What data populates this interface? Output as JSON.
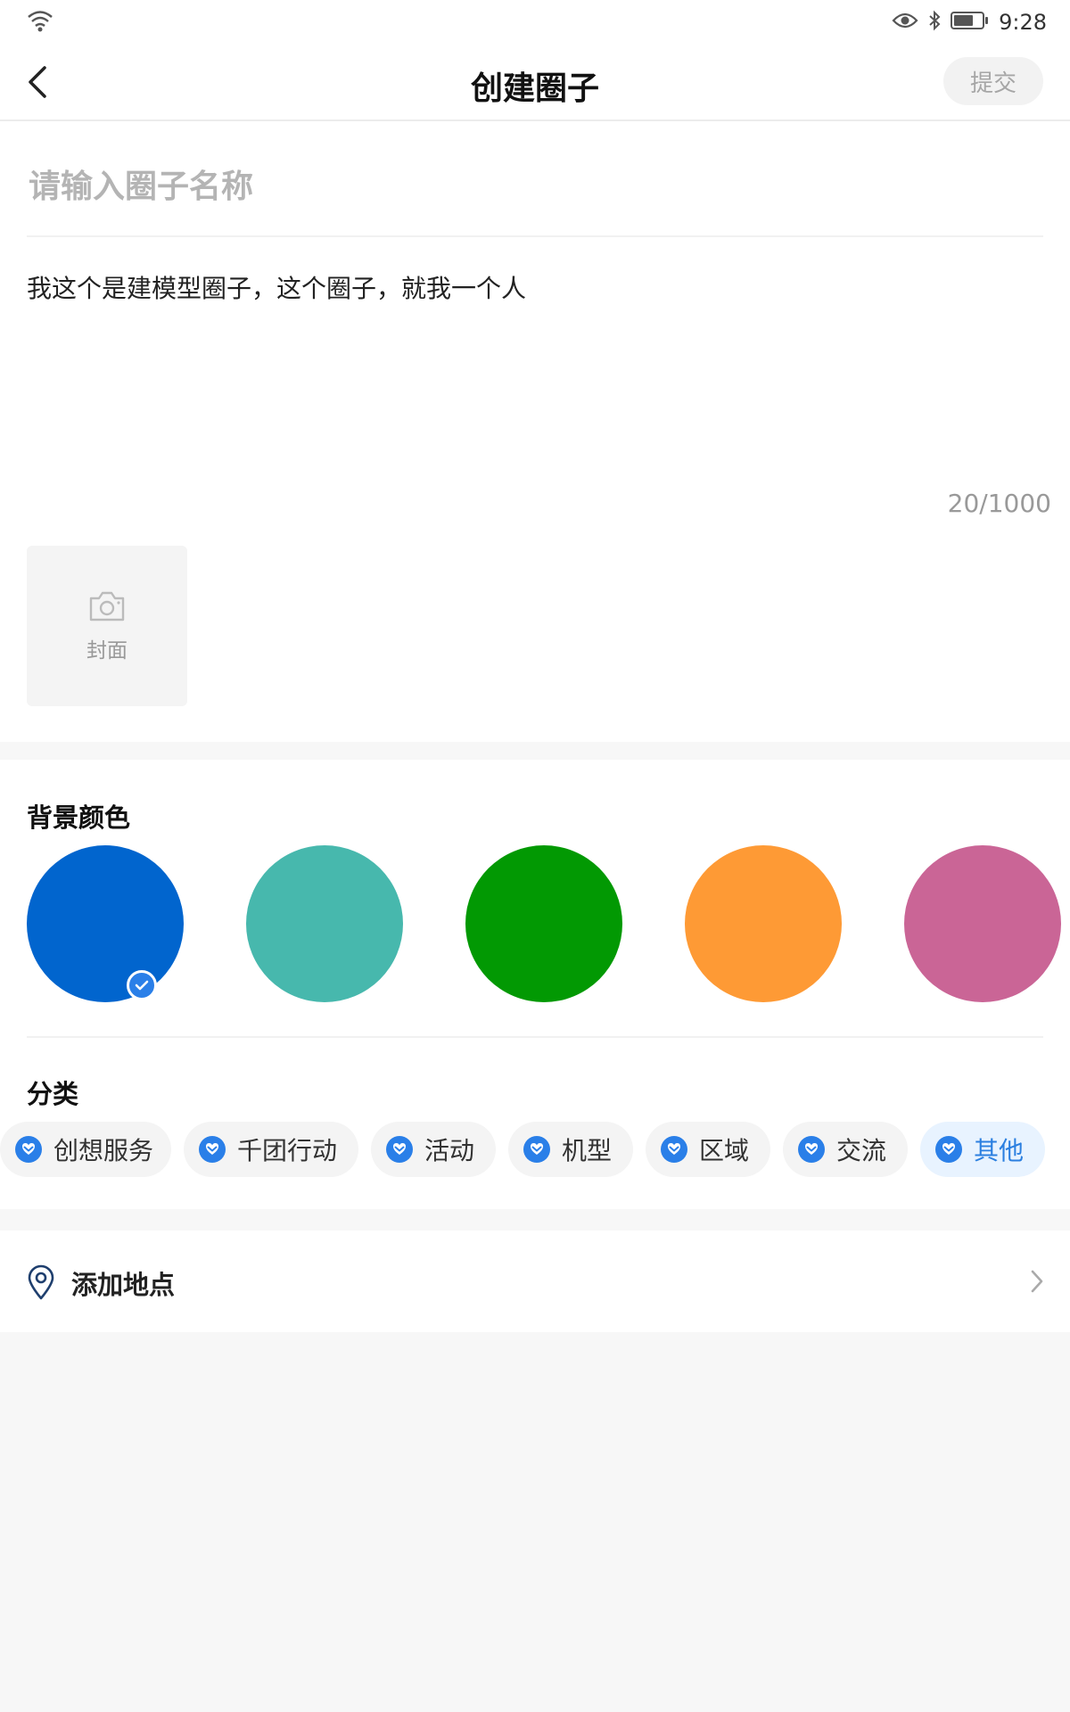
{
  "status_bar": {
    "time": "9:28"
  },
  "nav": {
    "title": "创建圈子",
    "submit_label": "提交"
  },
  "form": {
    "name_placeholder": "请输入圈子名称",
    "name_value": "",
    "description": "我这个是建模型圈子，这个圈子，就我一个人",
    "char_count": "20/1000",
    "cover_label": "封面"
  },
  "background_colors": {
    "title": "背景颜色",
    "swatches": [
      {
        "color": "#0165ce",
        "selected": true
      },
      {
        "color": "#47b8ad",
        "selected": false
      },
      {
        "color": "#029903",
        "selected": false
      },
      {
        "color": "#fe9a35",
        "selected": false
      },
      {
        "color": "#ca6596",
        "selected": false
      }
    ]
  },
  "category": {
    "title": "分类",
    "chips": [
      {
        "label": "创想服务",
        "selected": false
      },
      {
        "label": "千团行动",
        "selected": false
      },
      {
        "label": "活动",
        "selected": false
      },
      {
        "label": "机型",
        "selected": false
      },
      {
        "label": "区域",
        "selected": false
      },
      {
        "label": "交流",
        "selected": false
      },
      {
        "label": "其他",
        "selected": true
      }
    ]
  },
  "location": {
    "label": "添加地点"
  },
  "colors": {
    "accent": "#2a7fe8",
    "chip_selected_bg": "#e8f3ff"
  }
}
